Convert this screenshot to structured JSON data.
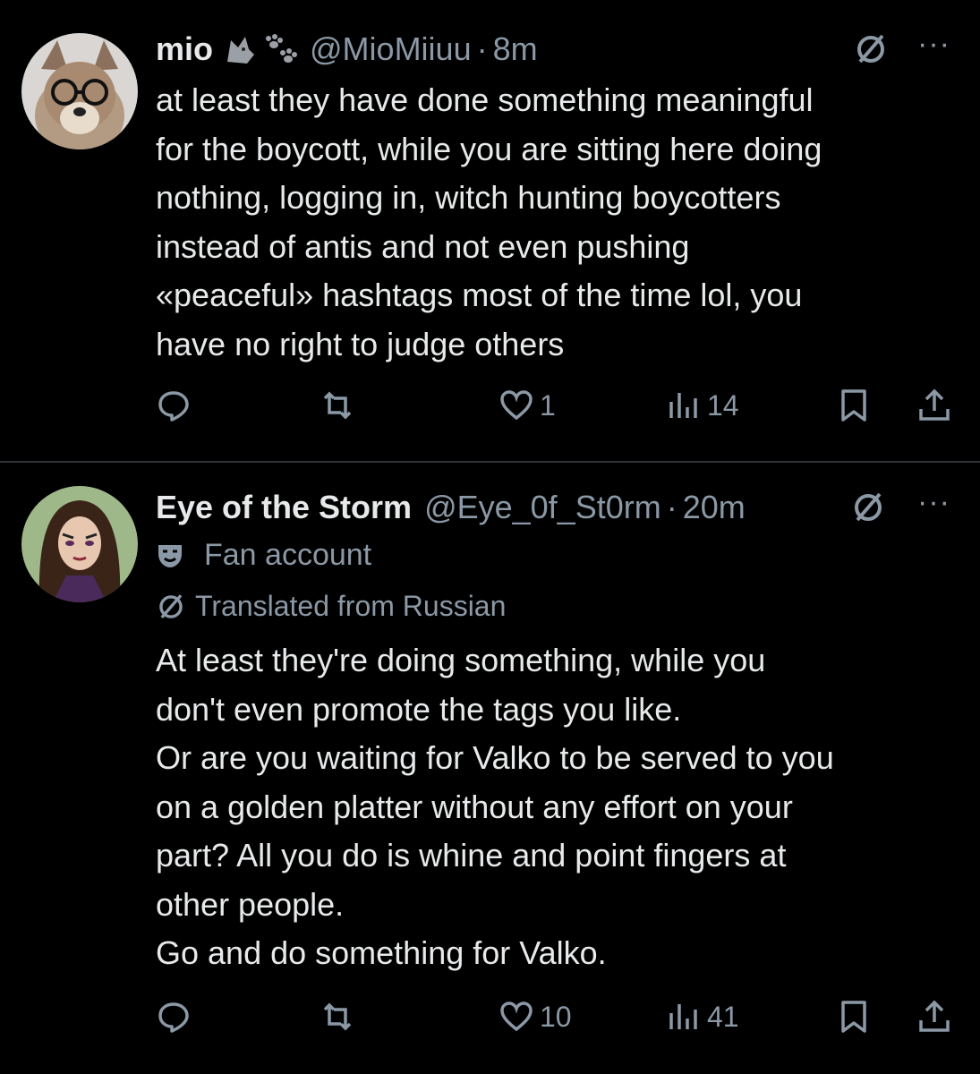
{
  "tweets": [
    {
      "name": "mio",
      "handle": "@MioMiiuu",
      "dot": "·",
      "time": "8m",
      "badge": "",
      "translated": "",
      "text": "at least they have done something meaningful\nfor the boycott, while you are sitting here doing\nnothing, logging in, witch hunting boycotters\ninstead of antis and not even pushing\n«peaceful» hashtags most of the time lol, you\nhave no right to judge others",
      "likes": "1",
      "views": "14",
      "name_emoji": [
        "wolf-icon",
        "paw-prints-icon"
      ]
    },
    {
      "name": "Eye of the Storm",
      "handle": "@Eye_0f_St0rm",
      "dot": "·",
      "time": "20m",
      "badge": "Fan account",
      "translated": "Translated from Russian",
      "text": "At least they're doing something, while you\ndon't even promote the tags you like.\nOr are you waiting for Valko to be served to you\non a golden platter without any effort on your\npart? All you do is whine and point fingers at\nother people.\nGo and do something for Valko.",
      "likes": "10",
      "views": "41"
    }
  ],
  "more_label": "···",
  "colors": {
    "background": "#000000",
    "text": "#e7e9ea",
    "secondary": "#8b98a5",
    "divider": "#2f3336"
  }
}
